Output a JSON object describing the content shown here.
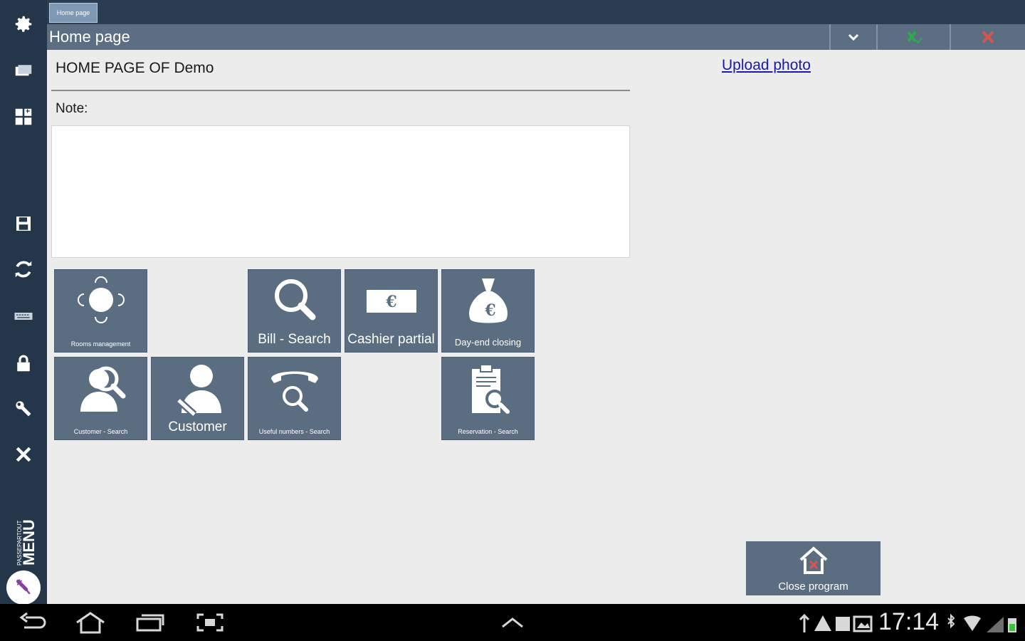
{
  "tabs": [
    {
      "label": "Home page"
    }
  ],
  "window": {
    "title": "Home page"
  },
  "page": {
    "heading": "HOME PAGE OF Demo",
    "note_label": "Note:",
    "note_value": "",
    "upload_photo": "Upload photo"
  },
  "tiles": [
    {
      "label": "Rooms management",
      "icon": "rooms-icon"
    },
    {
      "label": "Bill - Search",
      "icon": "search-icon"
    },
    {
      "label": "Cashier partial",
      "icon": "cash-register-icon"
    },
    {
      "label": "Day-end closing",
      "icon": "money-bag-icon"
    },
    {
      "label": "Customer - Search",
      "icon": "customer-search-icon"
    },
    {
      "label": "Customer",
      "icon": "customer-edit-icon"
    },
    {
      "label": "Useful numbers - Search",
      "icon": "phone-search-icon"
    },
    {
      "label": "Reservation - Search",
      "icon": "reservation-search-icon"
    }
  ],
  "close_program": {
    "label": "Close program"
  },
  "sidebar": {
    "brand_small": "PASSEPARTOUT",
    "brand_big": "MENU"
  },
  "status_bar": {
    "time": "17:14"
  },
  "colors": {
    "sidebar": "#24364a",
    "titlebar": "#5c6e82",
    "tile": "#5b6d80",
    "content_bg": "#ececec",
    "accept": "#2fa84f",
    "cancel": "#d9534f",
    "link": "#1a1aa8"
  }
}
